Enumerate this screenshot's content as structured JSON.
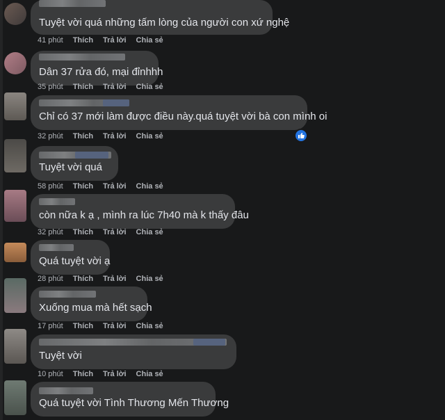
{
  "comments": [
    {
      "text": "Tuyệt vời quá những tấm lòng của người con xứ nghệ",
      "time": "41 phút",
      "like": "Thích",
      "reply": "Trả lời",
      "share": "Chia sẻ"
    },
    {
      "text": "Dân 37 rửa đó, mại đỉnhhh",
      "time": "35 phút",
      "like": "Thích",
      "reply": "Trả lời",
      "share": "Chia sẻ"
    },
    {
      "text": "Chỉ có 37 mới làm được điều này.quá tuyệt vời bà con mình oi",
      "time": "32 phút",
      "like": "Thích",
      "reply": "Trả lời",
      "share": "Chia sẻ",
      "reaction": "like-icon"
    },
    {
      "text": "Tuyệt vời quá",
      "time": "58 phút",
      "like": "Thích",
      "reply": "Trả lời",
      "share": "Chia sẻ"
    },
    {
      "text": "còn nữa k ạ , mình ra lúc 7h40 mà k thấy đâu",
      "time": "32 phút",
      "like": "Thích",
      "reply": "Trả lời",
      "share": "Chia sẻ"
    },
    {
      "text": "Quá tuyệt vời ạ",
      "time": "28 phút",
      "like": "Thích",
      "reply": "Trả lời",
      "share": "Chia sẻ"
    },
    {
      "text": "Xuống mua mà hết sạch",
      "time": "17 phút",
      "like": "Thích",
      "reply": "Trả lời",
      "share": "Chia sẻ"
    },
    {
      "text": "Tuyệt vời",
      "time": "10 phút",
      "like": "Thích",
      "reply": "Trả lời",
      "share": "Chia sẻ"
    },
    {
      "text": "Quá tuyệt vời Tình Thương Mến Thương",
      "time": "",
      "like": "",
      "reply": "",
      "share": ""
    }
  ],
  "colors": {
    "background": "#18191a",
    "bubble": "#3a3b3c",
    "text": "#e4e6eb",
    "meta": "#b0b3b8",
    "reaction": "#2374e1"
  }
}
